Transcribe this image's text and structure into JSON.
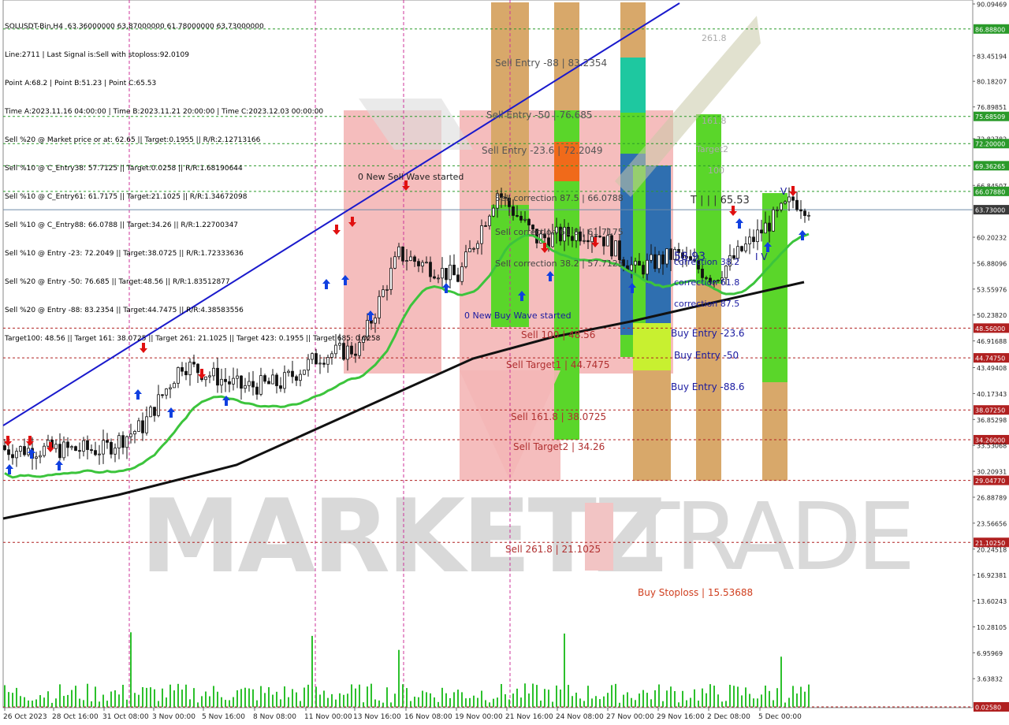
{
  "header": {
    "lines": [
      "SOLUSDT-Bin,H4  63.36000000 63.87000000 61.78000000 63.73000000",
      "Line:2711 | Last Signal is:Sell with stoploss:92.0109",
      "Point A:68.2 | Point B:51.23 | Point C:65.53",
      "Time A:2023.11.16 04:00:00 | Time B:2023.11.21 20:00:00 | Time C:2023.12.03 00:00:00",
      "Sell %20 @ Market price or at: 62.65 || Target:0.1955 || R/R:2.12713166",
      "Sell %10 @ C_Entry38: 57.7125 || Target:0.0258 || R/R:1.68190644",
      "Sell %10 @ C_Entry61: 61.7175 || Target:21.1025 || R/R:1.34672098",
      "Sell %10 @ C_Entry88: 66.0788 || Target:34.26 || R/R:1.22700347",
      "Sell %10 @ Entry -23: 72.2049 || Target:38.0725 || R/R:1.72333636",
      "Sell %20 @ Entry -50: 76.685 || Target:48.56 || R/R:1.83512877",
      "Sell %20 @ Entry -88: 83.2354 || Target:44.7475 || R/R:4.38583556",
      "Target100: 48.56 || Target 161: 38.0725 || Target 261: 21.1025 || Target 423: 0.1955 || Target 685: 0.0258"
    ]
  },
  "watermark": {
    "left": "MARKETZ",
    "right": "TRADE"
  },
  "chart_data": {
    "type": "candlestick",
    "symbol": "SOLUSDT-Bin",
    "timeframe": "H4",
    "ohlc_last": {
      "open": 63.36,
      "high": 63.87,
      "low": 61.78,
      "close": 63.73
    },
    "y_ticks": [
      "90.09469",
      "86.88800",
      "83.45194",
      "80.18207",
      "76.89851",
      "75.68509",
      "72.82782",
      "72.20000",
      "69.36265",
      "66.84507",
      "66.07880",
      "63.73000",
      "60.20232",
      "56.88096",
      "53.55976",
      "50.23820",
      "48.56000",
      "46.91688",
      "44.74750",
      "43.49408",
      "40.17343",
      "38.07250",
      "36.85298",
      "34.26000",
      "33.53068",
      "30.20931",
      "29.04770",
      "26.88789",
      "23.56656",
      "21.10250",
      "20.24518",
      "16.92381",
      "13.60243",
      "10.28105",
      "6.95969",
      "3.63832",
      "0.02580"
    ],
    "x_ticks": [
      "26 Oct 2023",
      "28 Oct 16:00",
      "31 Oct 08:00",
      "3 Nov 00:00",
      "5 Nov 16:00",
      "8 Nov 08:00",
      "11 Nov 00:00",
      "13 Nov 16:00",
      "16 Nov 08:00",
      "19 Nov 00:00",
      "21 Nov 16:00",
      "24 Nov 08:00",
      "27 Nov 00:00",
      "29 Nov 16:00",
      "2 Dec 08:00",
      "5 Dec 00:00"
    ],
    "level_lines": [
      {
        "value": "86.88800",
        "color": "#2a9a2a",
        "kind": "green"
      },
      {
        "value": "75.68509",
        "color": "#2a9a2a",
        "kind": "green"
      },
      {
        "value": "72.20000",
        "color": "#2a9a2a",
        "kind": "green"
      },
      {
        "value": "69.36265",
        "color": "#2a9a2a",
        "kind": "green"
      },
      {
        "value": "66.07880",
        "color": "#2a9a2a",
        "kind": "green"
      },
      {
        "value": "63.73000",
        "color": "#6e8aa8",
        "kind": "current"
      },
      {
        "value": "48.56000",
        "color": "#b02020",
        "kind": "red"
      },
      {
        "value": "44.74750",
        "color": "#b02020",
        "kind": "red"
      },
      {
        "value": "38.07250",
        "color": "#b02020",
        "kind": "red"
      },
      {
        "value": "34.26000",
        "color": "#b02020",
        "kind": "red"
      },
      {
        "value": "29.04770",
        "color": "#b02020",
        "kind": "red"
      },
      {
        "value": "21.10250",
        "color": "#b02020",
        "kind": "red"
      },
      {
        "value": "0.02580",
        "color": "#b02020",
        "kind": "red"
      }
    ],
    "annotations": [
      {
        "text": "261.8",
        "color": "#aaaaaa"
      },
      {
        "text": "Sell Entry -88 | 83.2354",
        "color": "#555555"
      },
      {
        "text": "Sell Entry -50 | 76.685",
        "color": "#555555"
      },
      {
        "text": "Sell Entry -23.6 | 72.2049",
        "color": "#555555"
      },
      {
        "text": "161.8",
        "color": "#aaaaaa"
      },
      {
        "text": "Target2",
        "color": "#aaaaaa"
      },
      {
        "text": "100",
        "color": "#aaaaaa"
      },
      {
        "text": "0 New Sell Wave started",
        "color": "#222222"
      },
      {
        "text": "Sell correction 87.5 | 66.0788",
        "color": "#444444"
      },
      {
        "text": "T | | | 65.53",
        "color": "#333333"
      },
      {
        "text": "Sell correction 61.8 | 61.7175",
        "color": "#444444"
      },
      {
        "text": "Sell correction 38.2 | 57.7125",
        "color": "#444444"
      },
      {
        "text": "58.93",
        "color": "#1a1aa0"
      },
      {
        "text": "correction 38.2",
        "color": "#1a1aa0"
      },
      {
        "text": "correction 61.8",
        "color": "#1a1aa0"
      },
      {
        "text": "correction 87.5",
        "color": "#1a1aa0"
      },
      {
        "text": "0 New Buy Wave started",
        "color": "#1a1aa0"
      },
      {
        "text": "Sell 100 | 48.56",
        "color": "#b03030"
      },
      {
        "text": "Buy Entry -23.6",
        "color": "#1a1aa0"
      },
      {
        "text": "Buy Entry -50",
        "color": "#1a1aa0"
      },
      {
        "text": "Sell Target1 | 44.7475",
        "color": "#b03030"
      },
      {
        "text": "Buy Entry -88.6",
        "color": "#1a1aa0"
      },
      {
        "text": "Sell 161.8 | 38.0725",
        "color": "#b03030"
      },
      {
        "text": "Sell Target2 | 34.26",
        "color": "#b03030"
      },
      {
        "text": "Sell 261.8 | 21.1025",
        "color": "#b03030"
      },
      {
        "text": "Buy Stoploss | 15.53688",
        "color": "#d04020"
      },
      {
        "text": "I V",
        "color": "#1a1aa0"
      },
      {
        "text": "V",
        "color": "#1a1aa0"
      }
    ],
    "colors": {
      "sell_zone": "#f4b6b6",
      "green_bar": "#5ad62a",
      "tan_bar": "#d8a86a",
      "blue_bar": "#2f6fb0",
      "teal_bar": "#1ec8a0",
      "orange_bar": "#f06a1a",
      "yellow_bar": "#c8f030",
      "ma_fast": "#3cc43c",
      "ma_slow": "#111111",
      "trend_line": "#1a1acc",
      "up_arrow": "#1040e0",
      "down_arrow": "#e01010",
      "volume": "#2cc02c"
    }
  }
}
